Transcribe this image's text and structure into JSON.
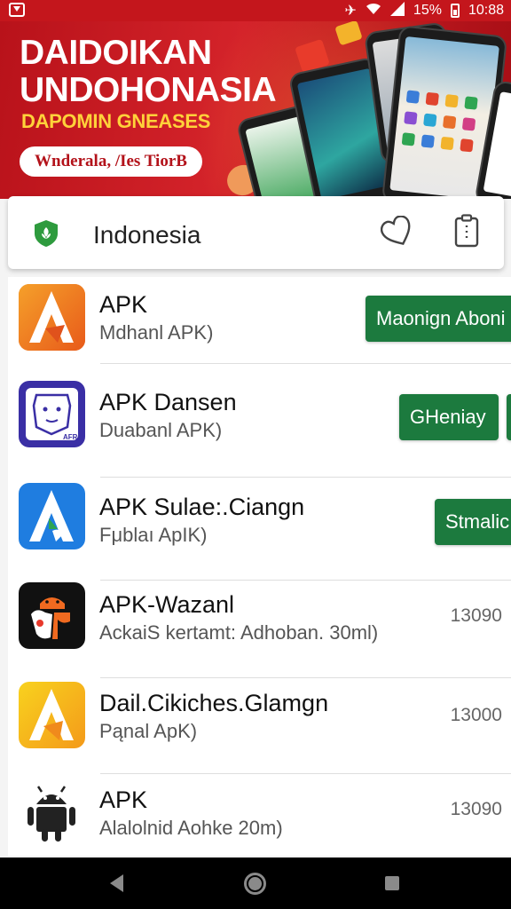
{
  "status_bar": {
    "notification_icon": "red-app-notification-icon",
    "battery": "15%",
    "time": "10:88"
  },
  "banner": {
    "title": "DAIDOIKAN\nUNDOHONASIA",
    "subtitle": "DAPOMIN GNEASES",
    "button_label": "Wnderala, /Ies TiorB"
  },
  "country_card": {
    "country": "Indonesia",
    "flag_icon": "green-shield-icon"
  },
  "apps": [
    {
      "title": "APK",
      "subtitle": "Mdhanl APK)",
      "action": "Maonign Aboni",
      "icon": "orange-a-icon"
    },
    {
      "title": "APK Dansen",
      "subtitle": "Duabanl APK)",
      "action": "GHeniay",
      "icon": "purple-face-icon"
    },
    {
      "title": "APK Sulae:.Ciangn",
      "subtitle": "Fμblaı ApIK)",
      "action": "Stmalic",
      "icon": "blue-a-icon"
    },
    {
      "title": "APK-Wazanl",
      "subtitle": "AckaiS kertamt: Adhoban. 30ml)",
      "count": "13090",
      "icon": "black-android-icon"
    },
    {
      "title": "Dail.Cikiches.Glamgn",
      "subtitle": "Pąnal ApK)",
      "count": "13000",
      "icon": "yellow-a-icon"
    },
    {
      "title": "APK",
      "subtitle": "Alalolnid Aohke 20m)",
      "count": "13090",
      "icon": "android-robot-icon"
    }
  ],
  "colors": {
    "banner_red": "#c4161c",
    "action_green": "#1c7a3e",
    "subtitle_yellow": "#ffd23a"
  }
}
